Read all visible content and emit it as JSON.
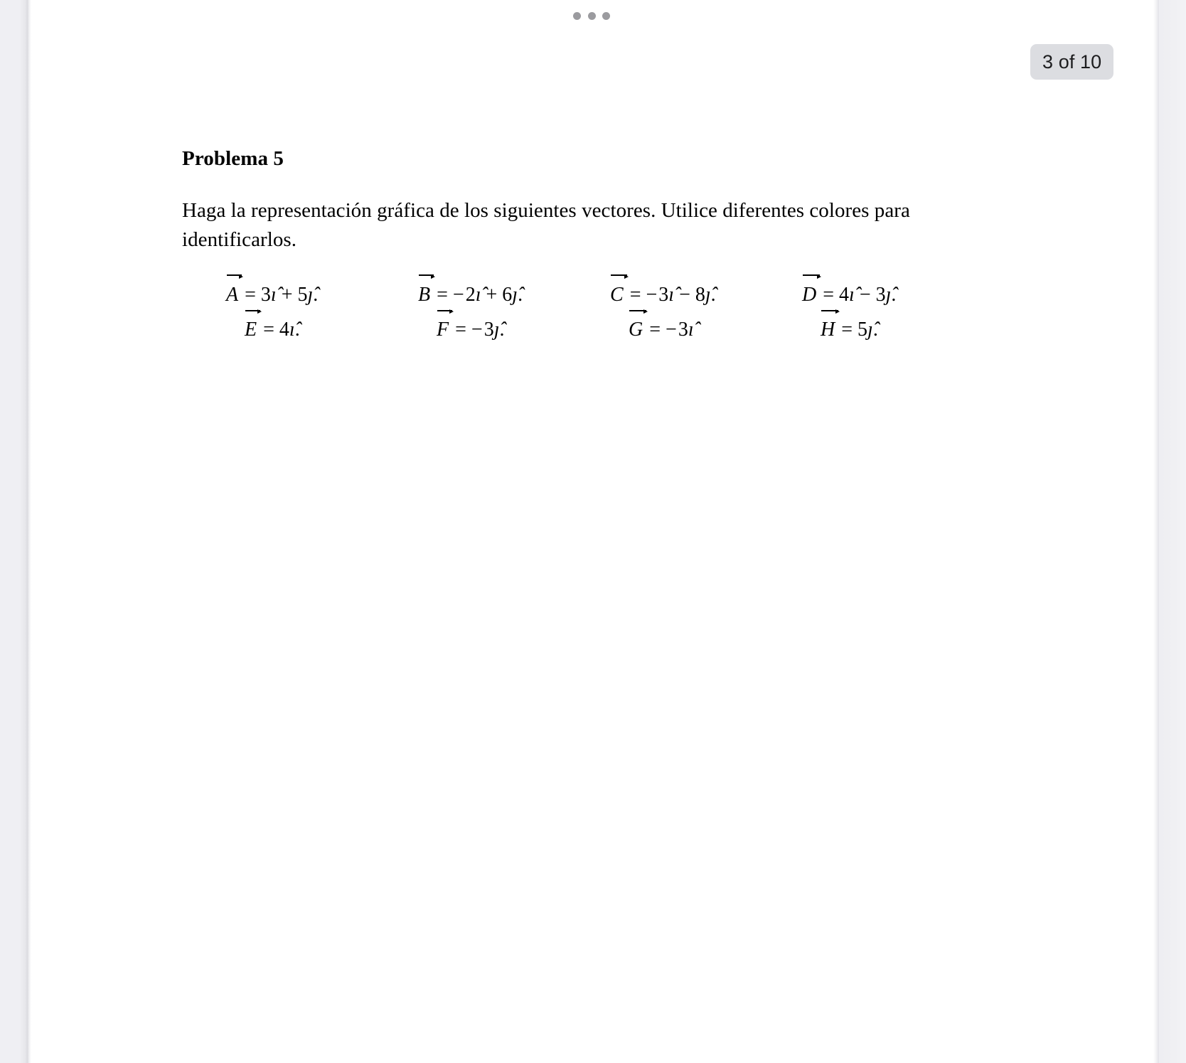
{
  "viewer": {
    "overflow_menu": {
      "icon": "three-dots-icon",
      "dots": [
        "dot",
        "dot",
        "dot"
      ]
    },
    "page_badge": {
      "label": "3 of 10",
      "current_page": 3,
      "total_pages": 10,
      "background_color": "#dcdde1",
      "text_color": "#1d1d1f"
    },
    "scrollbar": {
      "thumb_color": "#9a9aa0",
      "track_color": "#eeeef2"
    },
    "background_color": "#efeff3",
    "page_color": "#ffffff"
  },
  "document": {
    "title": "Problema 5",
    "instruction": "Haga la representación gráfica de los siguientes vectores. Utilice diferentes colores para identificarlos.",
    "equations": {
      "row1": [
        {
          "name": "vector-a",
          "letter": "A",
          "equals": "=",
          "terms": [
            {
              "sign": "",
              "coefficient": "3",
              "unit": "ı̂"
            },
            {
              "sign": "+",
              "coefficient": "5",
              "unit": "ȷ̂"
            }
          ],
          "punctuation": ".",
          "plain": "A⃗ = 3î + 5ĵ."
        },
        {
          "name": "vector-b",
          "letter": "B",
          "equals": "=",
          "terms": [
            {
              "sign": "−",
              "coefficient": "2",
              "unit": "ı̂"
            },
            {
              "sign": "+",
              "coefficient": "6",
              "unit": "ȷ̂"
            }
          ],
          "punctuation": ".",
          "plain": "B⃗ = −2î + 6ĵ."
        },
        {
          "name": "vector-c",
          "letter": "C",
          "equals": "=",
          "terms": [
            {
              "sign": "−",
              "coefficient": "3",
              "unit": "ı̂"
            },
            {
              "sign": "−",
              "coefficient": "8",
              "unit": "ȷ̂"
            }
          ],
          "punctuation": ".",
          "plain": "C⃗ = −3î − 8ĵ."
        },
        {
          "name": "vector-d",
          "letter": "D",
          "equals": "=",
          "terms": [
            {
              "sign": "",
              "coefficient": "4",
              "unit": "ı̂"
            },
            {
              "sign": "−",
              "coefficient": "3",
              "unit": "ȷ̂"
            }
          ],
          "punctuation": ".",
          "plain": "D⃗ = 4î − 3ĵ."
        }
      ],
      "row2": [
        {
          "name": "vector-e",
          "letter": "E",
          "equals": "=",
          "terms": [
            {
              "sign": "",
              "coefficient": "4",
              "unit": "ı̂"
            }
          ],
          "punctuation": ".",
          "plain": "E⃗ = 4î."
        },
        {
          "name": "vector-f",
          "letter": "F",
          "equals": "=",
          "terms": [
            {
              "sign": "−",
              "coefficient": "3",
              "unit": "ȷ̂"
            }
          ],
          "punctuation": ".",
          "plain": "F⃗ = −3ĵ."
        },
        {
          "name": "vector-g",
          "letter": "G",
          "equals": "=",
          "terms": [
            {
              "sign": "−",
              "coefficient": "3",
              "unit": "ı̂"
            }
          ],
          "punctuation": "",
          "plain": "G⃗ = −3î"
        },
        {
          "name": "vector-h",
          "letter": "H",
          "equals": "=",
          "terms": [
            {
              "sign": "",
              "coefficient": "5",
              "unit": "ȷ̂"
            }
          ],
          "punctuation": ".",
          "plain": "H⃗ = 5ĵ."
        }
      ]
    }
  }
}
